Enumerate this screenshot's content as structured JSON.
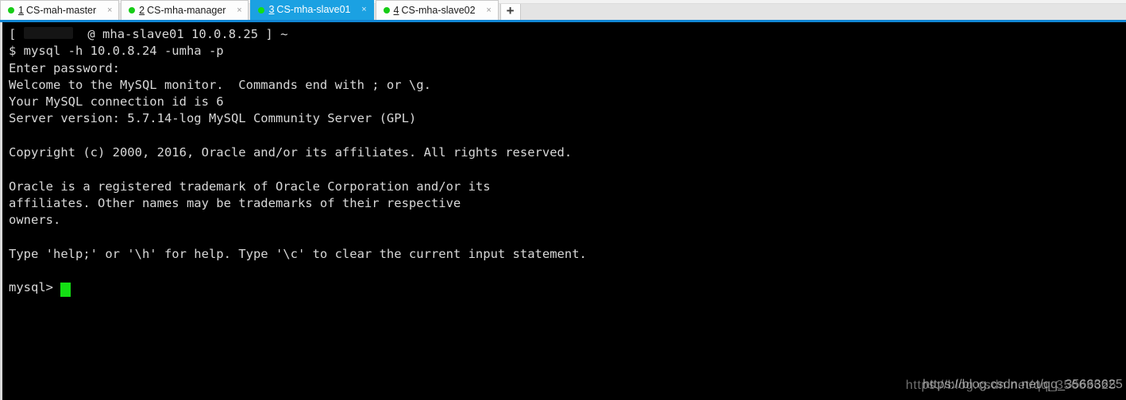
{
  "window": {
    "title": "CS-mha-slave01",
    "accent_color": "#1ba1e2",
    "chrome_color": "#e4e4e4",
    "separator_color": "#1186d4",
    "terminal_bg": "#000000",
    "terminal_fg": "#d8d8d8",
    "cursor_color": "#14e014",
    "tab_dot_color": "#16cc16"
  },
  "tab_strip": {
    "new_tab_label": "+",
    "close_label": "×",
    "tabs": [
      {
        "index": "1",
        "label": "CS-mah-master",
        "active": false,
        "status_icon": "green-dot-icon"
      },
      {
        "index": "2",
        "label": "CS-mha-manager",
        "active": false,
        "status_icon": "green-dot-icon"
      },
      {
        "index": "3",
        "label": "CS-mha-slave01",
        "active": true,
        "status_icon": "green-dot-icon"
      },
      {
        "index": "4",
        "label": "CS-mha-slave02",
        "active": false,
        "status_icon": "green-dot-icon"
      }
    ]
  },
  "terminal": {
    "shell_prompt": {
      "open_bracket": "[",
      "user_redacted": true,
      "at": "@",
      "host": "mha-slave01",
      "ip": "10.0.8.25",
      "close_bracket": "]",
      "path": "~"
    },
    "lines": [
      {
        "id": "prompt-host-line",
        "type": "prompt-host",
        "text": "[          @ mha-slave01 10.0.8.25 ] ~"
      },
      {
        "id": "command-line",
        "type": "command",
        "text": "$ mysql -h 10.0.8.24 -umha -p"
      },
      {
        "id": "password-prompt",
        "type": "output",
        "text": "Enter password:"
      },
      {
        "id": "welcome-line",
        "type": "output",
        "text": "Welcome to the MySQL monitor.  Commands end with ; or \\g."
      },
      {
        "id": "connection-id",
        "type": "output",
        "text": "Your MySQL connection id is 6"
      },
      {
        "id": "server-version",
        "type": "output",
        "text": "Server version: 5.7.14-log MySQL Community Server (GPL)"
      },
      {
        "id": "blank-1",
        "type": "blank",
        "text": " "
      },
      {
        "id": "copyright",
        "type": "output",
        "text": "Copyright (c) 2000, 2016, Oracle and/or its affiliates. All rights reserved."
      },
      {
        "id": "blank-2",
        "type": "blank",
        "text": " "
      },
      {
        "id": "trademark-1",
        "type": "output",
        "text": "Oracle is a registered trademark of Oracle Corporation and/or its"
      },
      {
        "id": "trademark-2",
        "type": "output",
        "text": "affiliates. Other names may be trademarks of their respective"
      },
      {
        "id": "trademark-3",
        "type": "output",
        "text": "owners."
      },
      {
        "id": "blank-3",
        "type": "blank",
        "text": " "
      },
      {
        "id": "help-hint",
        "type": "output",
        "text": "Type 'help;' or '\\h' for help. Type '\\c' to clear the current input statement."
      },
      {
        "id": "blank-4",
        "type": "blank",
        "text": " "
      }
    ],
    "mysql_prompt": "mysql>"
  },
  "watermark": {
    "primary": "https://blog.csdn.net/qq_35663625",
    "secondary": "https://blog.csdn.net/qq_35663625"
  }
}
